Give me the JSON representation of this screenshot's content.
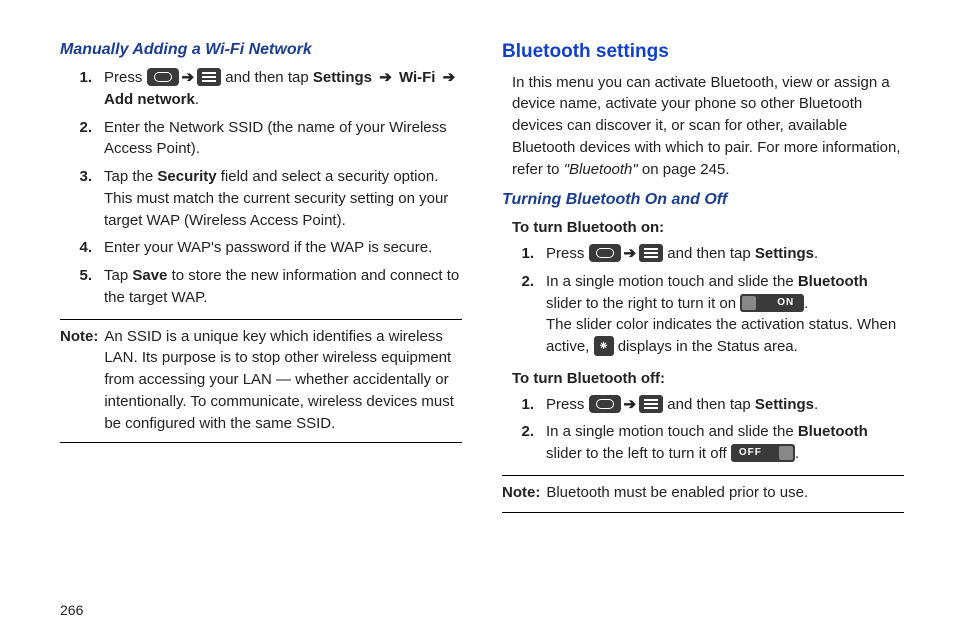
{
  "page_number": "266",
  "left": {
    "heading": "Manually Adding a Wi-Fi Network",
    "steps": {
      "s1_a": "Press ",
      "s1_b": " and then tap ",
      "s1_settings": "Settings",
      "s1_wifi": "Wi-Fi ",
      "s1_add": "Add network",
      "s1_end": ".",
      "s2": "Enter the Network SSID (the name of your Wireless Access Point).",
      "s3_a": "Tap the ",
      "s3_sec": "Security",
      "s3_b": " field and select a security option. This must match the current security setting on your target WAP (Wireless Access Point).",
      "s4": "Enter your WAP's password if the WAP is secure.",
      "s5_a": "Tap ",
      "s5_save": "Save",
      "s5_b": " to store the new information and connect to the target WAP."
    },
    "note_label": "Note:",
    "note_body": "An SSID is a unique key which identifies a wireless LAN. Its purpose is to stop other wireless equipment from accessing your LAN — whether accidentally or intentionally. To communicate, wireless devices must be configured with the same SSID."
  },
  "right": {
    "heading": "Bluetooth settings",
    "intro_a": "In this menu you can activate Bluetooth, view or assign a device name, activate your phone so other Bluetooth devices can discover it, or scan for other, available Bluetooth devices with which to pair. For more information, refer to ",
    "intro_ref": "\"Bluetooth\"",
    "intro_b": " on page 245.",
    "sub_heading": "Turning Bluetooth On and Off",
    "on_label": "To turn Bluetooth on:",
    "on_s1_a": "Press ",
    "on_s1_b": " and then tap ",
    "on_s1_settings": "Settings",
    "on_s1_end": ".",
    "on_s2_a": "In a single motion touch and slide the ",
    "on_s2_bt": "Bluetooth",
    "on_s2_b": " slider to the right to turn it on ",
    "on_s2_c": ".",
    "on_s2_d": "The slider color indicates the activation status. When active, ",
    "on_s2_e": " displays in the Status area.",
    "toggle_on": "ON",
    "off_label": "To turn Bluetooth off:",
    "off_s1_a": "Press ",
    "off_s1_b": " and then tap ",
    "off_s1_settings": "Settings",
    "off_s1_end": ".",
    "off_s2_a": "In a single motion touch and slide the ",
    "off_s2_bt": "Bluetooth",
    "off_s2_b": " slider to the left to turn it off ",
    "off_s2_c": ".",
    "toggle_off": "OFF",
    "note_label": "Note:",
    "note_body": "Bluetooth must be enabled prior to use."
  }
}
